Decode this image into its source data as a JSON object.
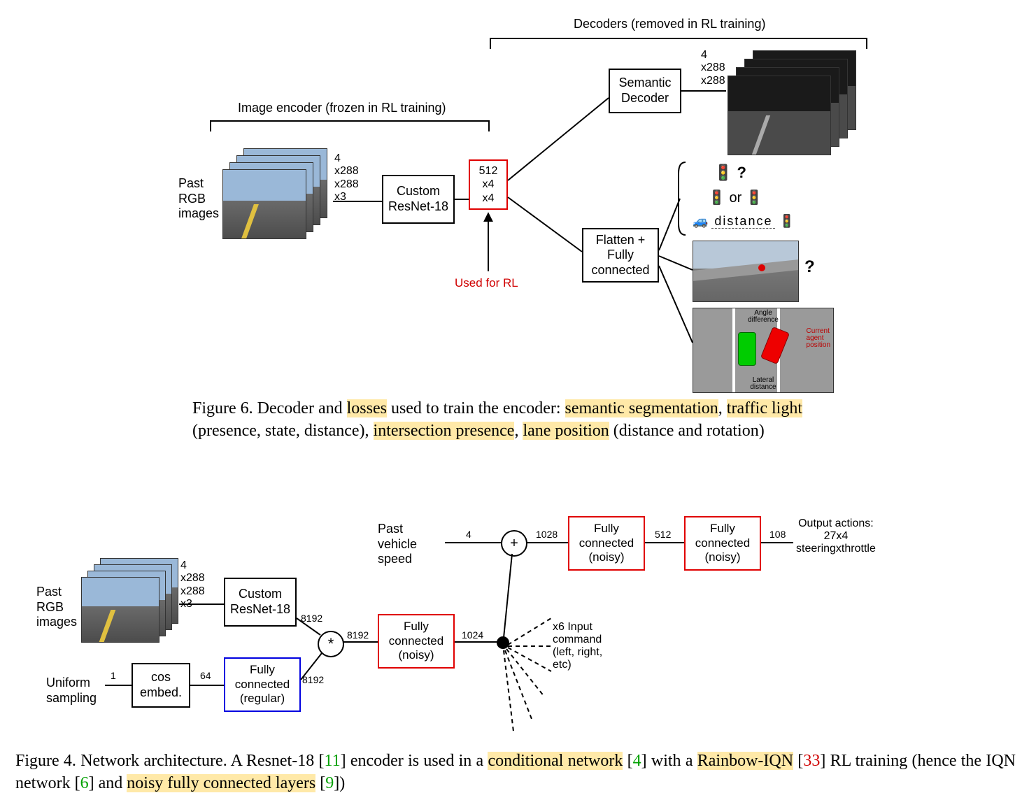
{
  "figA": {
    "encoder_label": "Image encoder (frozen in RL training)",
    "decoder_label": "Decoders (removed in RL training)",
    "input_label": "Past\nRGB\nimages",
    "input_dims": "4\nx288\nx288\nx3",
    "resnet": "Custom\nResNet-18",
    "feat_box": "512\nx4\nx4",
    "used_for_rl": "Used for RL",
    "semantic_decoder": "Semantic\nDecoder",
    "sem_dims": "4\nx288\nx288",
    "flatten_fc": "Flatten +\nFully\nconnected",
    "task_q1": "?",
    "task_or": "or",
    "task_distance": "distance",
    "task_q2": "?",
    "lane_angle": "Angle\ndifference",
    "lane_current": "Current\nagent\nposition",
    "lane_lateral": "Lateral\ndistance"
  },
  "captionA": {
    "prefix": "Figure 6. Decoder and ",
    "losses": "losses",
    "mid1": " used to train the encoder: ",
    "semseg": "semantic segmentation",
    "sep1": ", ",
    "traffic": "traffic light",
    "mid2": " (presence, state, distance), ",
    "intersection": "intersection presence",
    "sep2": ", ",
    "lanepos": "lane position",
    "tail": " (distance and rotation)"
  },
  "figB": {
    "input_label": "Past\nRGB\nimages",
    "input_dims": "4\nx288\nx288\nx3",
    "resnet": "Custom\nResNet-18",
    "uniform": "Uniform\nsampling",
    "cos_embed": "cos\nembed.",
    "fc_regular": "Fully\nconnected\n(regular)",
    "fc_noisy": "Fully\nconnected\n(noisy)",
    "past_speed": "Past\nvehicle\nspeed",
    "cmd": "x6 Input\ncommand\n(left, right,\netc)",
    "out_label": "Output actions:\n27x4\nsteeringxthrottle",
    "n1": "1",
    "n64": "64",
    "n8192a": "8192",
    "n8192b": "8192",
    "n8192c": "8192",
    "n1024": "1024",
    "n4": "4",
    "n1028": "1028",
    "n512": "512",
    "n108": "108",
    "mult": "*",
    "plus": "+"
  },
  "captionB": {
    "prefix": "Figure 4. Network architecture.  A Resnet-18 [",
    "cite11": "11",
    "mid1": "] encoder is used in a ",
    "condnet": "conditional network",
    "mid2": " [",
    "cite4": "4",
    "mid3": "] with a ",
    "rainbow": "Rainbow-IQN",
    "mid4": " [",
    "cite33": "33",
    "mid5": "] RL training (hence the IQN network [",
    "cite6": "6",
    "mid6": "] and ",
    "noisyfc": "noisy fully connected layers",
    "mid7": " [",
    "cite9": "9",
    "tail": "])"
  }
}
